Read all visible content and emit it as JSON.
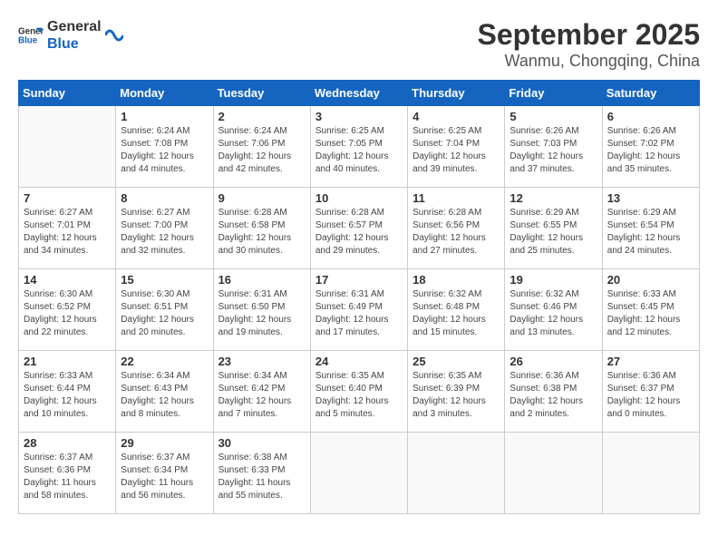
{
  "header": {
    "logo_general": "General",
    "logo_blue": "Blue",
    "month": "September 2025",
    "location": "Wanmu, Chongqing, China"
  },
  "days_of_week": [
    "Sunday",
    "Monday",
    "Tuesday",
    "Wednesday",
    "Thursday",
    "Friday",
    "Saturday"
  ],
  "weeks": [
    [
      {
        "day": "",
        "info": ""
      },
      {
        "day": "1",
        "info": "Sunrise: 6:24 AM\nSunset: 7:08 PM\nDaylight: 12 hours\nand 44 minutes."
      },
      {
        "day": "2",
        "info": "Sunrise: 6:24 AM\nSunset: 7:06 PM\nDaylight: 12 hours\nand 42 minutes."
      },
      {
        "day": "3",
        "info": "Sunrise: 6:25 AM\nSunset: 7:05 PM\nDaylight: 12 hours\nand 40 minutes."
      },
      {
        "day": "4",
        "info": "Sunrise: 6:25 AM\nSunset: 7:04 PM\nDaylight: 12 hours\nand 39 minutes."
      },
      {
        "day": "5",
        "info": "Sunrise: 6:26 AM\nSunset: 7:03 PM\nDaylight: 12 hours\nand 37 minutes."
      },
      {
        "day": "6",
        "info": "Sunrise: 6:26 AM\nSunset: 7:02 PM\nDaylight: 12 hours\nand 35 minutes."
      }
    ],
    [
      {
        "day": "7",
        "info": "Sunrise: 6:27 AM\nSunset: 7:01 PM\nDaylight: 12 hours\nand 34 minutes."
      },
      {
        "day": "8",
        "info": "Sunrise: 6:27 AM\nSunset: 7:00 PM\nDaylight: 12 hours\nand 32 minutes."
      },
      {
        "day": "9",
        "info": "Sunrise: 6:28 AM\nSunset: 6:58 PM\nDaylight: 12 hours\nand 30 minutes."
      },
      {
        "day": "10",
        "info": "Sunrise: 6:28 AM\nSunset: 6:57 PM\nDaylight: 12 hours\nand 29 minutes."
      },
      {
        "day": "11",
        "info": "Sunrise: 6:28 AM\nSunset: 6:56 PM\nDaylight: 12 hours\nand 27 minutes."
      },
      {
        "day": "12",
        "info": "Sunrise: 6:29 AM\nSunset: 6:55 PM\nDaylight: 12 hours\nand 25 minutes."
      },
      {
        "day": "13",
        "info": "Sunrise: 6:29 AM\nSunset: 6:54 PM\nDaylight: 12 hours\nand 24 minutes."
      }
    ],
    [
      {
        "day": "14",
        "info": "Sunrise: 6:30 AM\nSunset: 6:52 PM\nDaylight: 12 hours\nand 22 minutes."
      },
      {
        "day": "15",
        "info": "Sunrise: 6:30 AM\nSunset: 6:51 PM\nDaylight: 12 hours\nand 20 minutes."
      },
      {
        "day": "16",
        "info": "Sunrise: 6:31 AM\nSunset: 6:50 PM\nDaylight: 12 hours\nand 19 minutes."
      },
      {
        "day": "17",
        "info": "Sunrise: 6:31 AM\nSunset: 6:49 PM\nDaylight: 12 hours\nand 17 minutes."
      },
      {
        "day": "18",
        "info": "Sunrise: 6:32 AM\nSunset: 6:48 PM\nDaylight: 12 hours\nand 15 minutes."
      },
      {
        "day": "19",
        "info": "Sunrise: 6:32 AM\nSunset: 6:46 PM\nDaylight: 12 hours\nand 13 minutes."
      },
      {
        "day": "20",
        "info": "Sunrise: 6:33 AM\nSunset: 6:45 PM\nDaylight: 12 hours\nand 12 minutes."
      }
    ],
    [
      {
        "day": "21",
        "info": "Sunrise: 6:33 AM\nSunset: 6:44 PM\nDaylight: 12 hours\nand 10 minutes."
      },
      {
        "day": "22",
        "info": "Sunrise: 6:34 AM\nSunset: 6:43 PM\nDaylight: 12 hours\nand 8 minutes."
      },
      {
        "day": "23",
        "info": "Sunrise: 6:34 AM\nSunset: 6:42 PM\nDaylight: 12 hours\nand 7 minutes."
      },
      {
        "day": "24",
        "info": "Sunrise: 6:35 AM\nSunset: 6:40 PM\nDaylight: 12 hours\nand 5 minutes."
      },
      {
        "day": "25",
        "info": "Sunrise: 6:35 AM\nSunset: 6:39 PM\nDaylight: 12 hours\nand 3 minutes."
      },
      {
        "day": "26",
        "info": "Sunrise: 6:36 AM\nSunset: 6:38 PM\nDaylight: 12 hours\nand 2 minutes."
      },
      {
        "day": "27",
        "info": "Sunrise: 6:36 AM\nSunset: 6:37 PM\nDaylight: 12 hours\nand 0 minutes."
      }
    ],
    [
      {
        "day": "28",
        "info": "Sunrise: 6:37 AM\nSunset: 6:36 PM\nDaylight: 11 hours\nand 58 minutes."
      },
      {
        "day": "29",
        "info": "Sunrise: 6:37 AM\nSunset: 6:34 PM\nDaylight: 11 hours\nand 56 minutes."
      },
      {
        "day": "30",
        "info": "Sunrise: 6:38 AM\nSunset: 6:33 PM\nDaylight: 11 hours\nand 55 minutes."
      },
      {
        "day": "",
        "info": ""
      },
      {
        "day": "",
        "info": ""
      },
      {
        "day": "",
        "info": ""
      },
      {
        "day": "",
        "info": ""
      }
    ]
  ]
}
